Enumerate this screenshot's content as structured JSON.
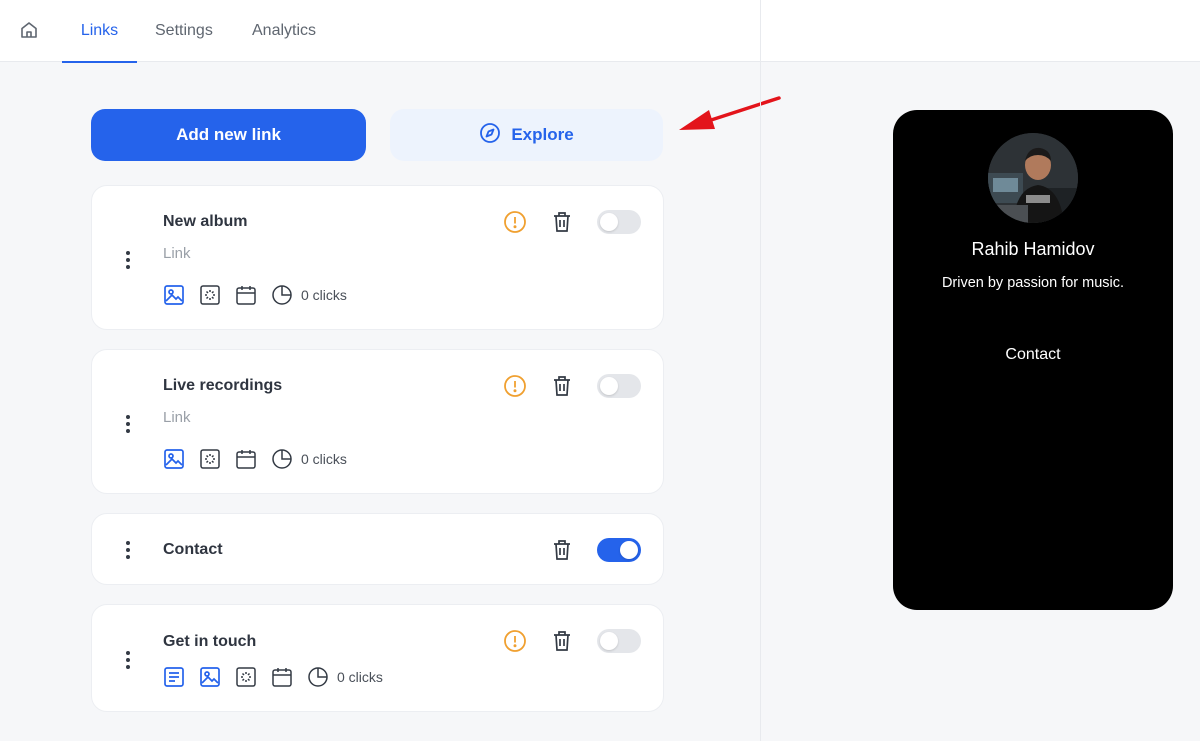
{
  "nav": {
    "tabs": [
      {
        "label": "Links",
        "active": true
      },
      {
        "label": "Settings",
        "active": false
      },
      {
        "label": "Analytics",
        "active": false
      }
    ]
  },
  "actions": {
    "add_label": "Add new link",
    "explore_label": "Explore"
  },
  "links": [
    {
      "title": "New album",
      "subtitle": "Link",
      "clicks": "0 clicks",
      "enabled": false,
      "warning": true
    },
    {
      "title": "Live recordings",
      "subtitle": "Link",
      "clicks": "0 clicks",
      "enabled": false,
      "warning": true
    },
    {
      "title": "Contact",
      "enabled": true,
      "warning": false
    },
    {
      "title": "Get in touch",
      "clicks": "0 clicks",
      "enabled": false,
      "warning": true
    }
  ],
  "preview": {
    "name": "Rahib Hamidov",
    "bio": "Driven by passion for music.",
    "link_label": "Contact"
  },
  "colors": {
    "accent": "#2563eb",
    "warning": "#f0a030",
    "annotation_arrow": "#e3141b"
  }
}
